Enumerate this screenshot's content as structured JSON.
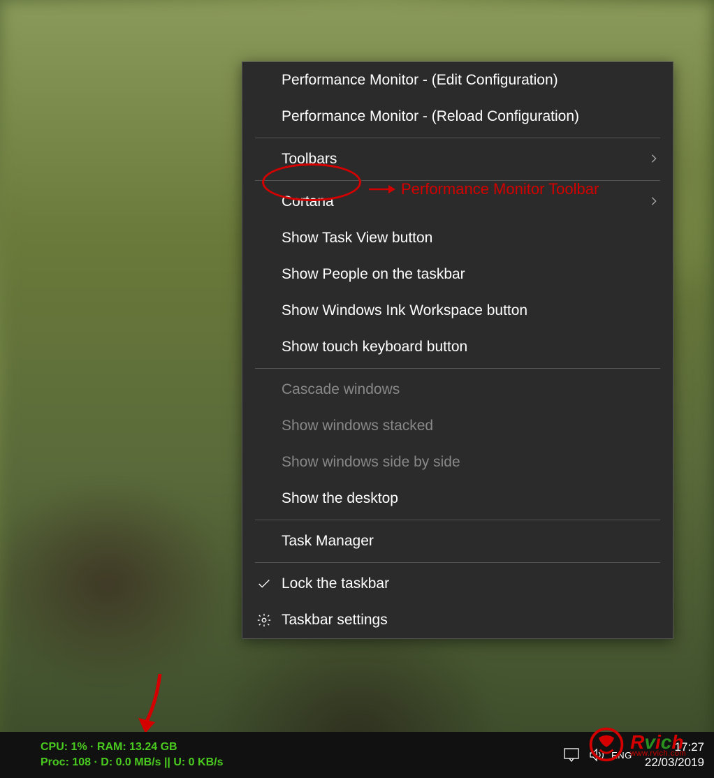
{
  "menu": {
    "items": [
      {
        "label": "Performance Monitor - (Edit Configuration)",
        "interactable": true
      },
      {
        "label": "Performance Monitor - (Reload Configuration)",
        "interactable": true
      }
    ],
    "toolbars": {
      "label": "Toolbars"
    },
    "cortana": {
      "label": "Cortana"
    },
    "show_task_view": {
      "label": "Show Task View button"
    },
    "show_people": {
      "label": "Show People on the taskbar"
    },
    "show_ink": {
      "label": "Show Windows Ink Workspace button"
    },
    "show_touch_kb": {
      "label": "Show touch keyboard button"
    },
    "cascade": {
      "label": "Cascade windows"
    },
    "stacked": {
      "label": "Show windows stacked"
    },
    "side_by_side": {
      "label": "Show windows side by side"
    },
    "show_desktop": {
      "label": "Show the desktop"
    },
    "task_manager": {
      "label": "Task Manager"
    },
    "lock_taskbar": {
      "label": "Lock the taskbar"
    },
    "taskbar_settings": {
      "label": "Taskbar settings"
    }
  },
  "annotation": {
    "label": "Performance Monitor Toolbar"
  },
  "taskbar": {
    "perf_line1": "CPU: 1% · RAM: 13.24 GB",
    "perf_line2": "Proc: 108 · D: 0.0 MB/s || U: 0 KB/s",
    "ime": "ENG",
    "time": "17:27",
    "date": "22/03/2019"
  },
  "watermark": {
    "brand": "Rvich",
    "sub": "www.rvich.com"
  }
}
